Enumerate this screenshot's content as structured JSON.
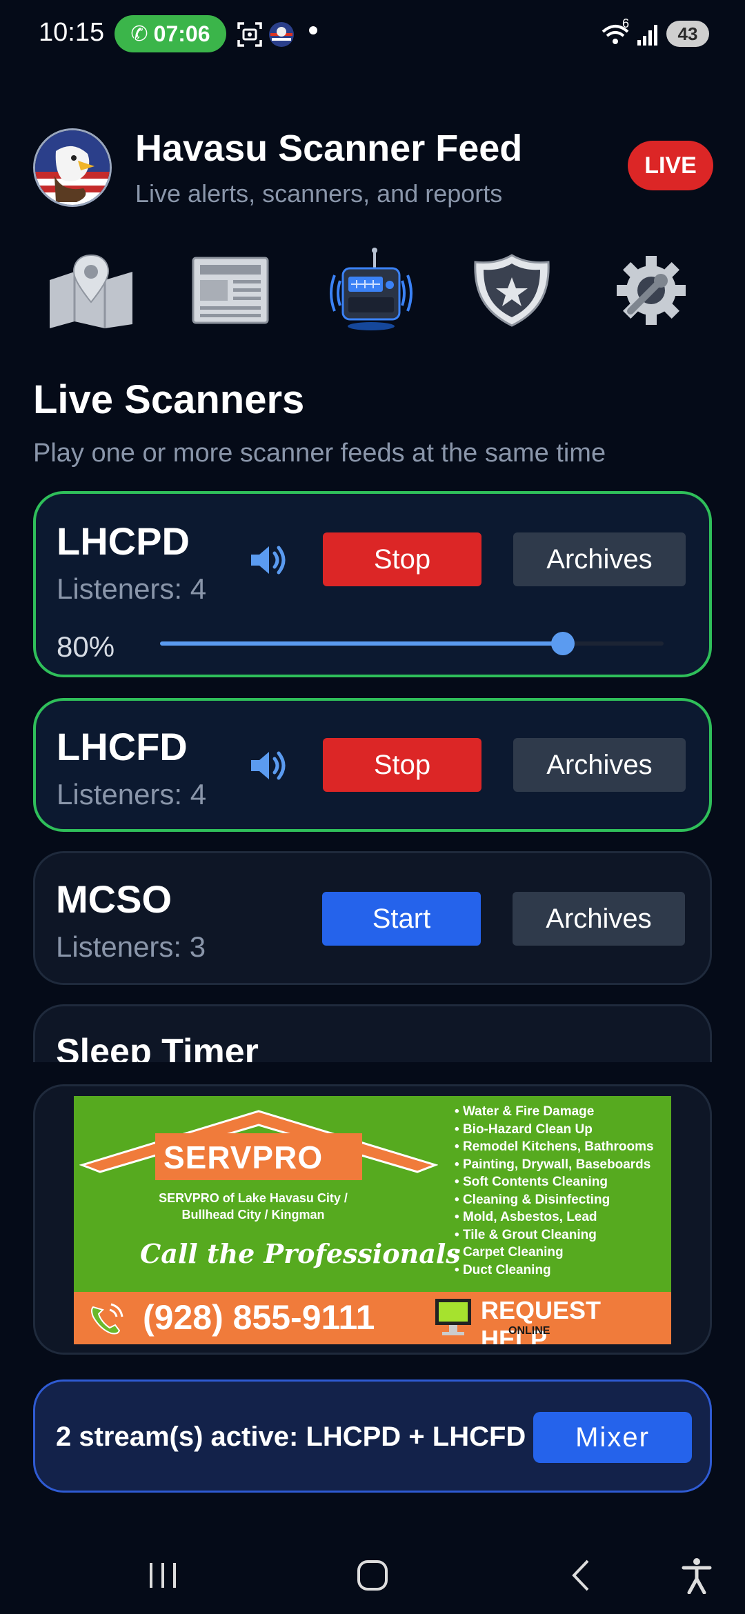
{
  "status_bar": {
    "time": "10:15",
    "call_time": "07:06",
    "battery": "43",
    "network_label": "6"
  },
  "header": {
    "title": "Havasu Scanner Feed",
    "subtitle": "Live alerts, scanners, and reports",
    "live_badge": "LIVE"
  },
  "nav": [
    {
      "icon": "map-pin-icon"
    },
    {
      "icon": "newspaper-icon"
    },
    {
      "icon": "radio-scanner-icon"
    },
    {
      "icon": "police-badge-icon"
    },
    {
      "icon": "settings-gear-icon"
    }
  ],
  "section": {
    "title": "Live Scanners",
    "subtitle": "Play one or more scanner feeds at the same time"
  },
  "feeds": [
    {
      "name": "LHCPD",
      "listeners": "Listeners: 4",
      "action": "Stop",
      "archives": "Archives",
      "volume_label": "80%",
      "volume": 0.8,
      "active": true
    },
    {
      "name": "LHCFD",
      "listeners": "Listeners: 4",
      "action": "Stop",
      "archives": "Archives",
      "active": true
    },
    {
      "name": "MCSO",
      "listeners": "Listeners: 3",
      "action": "Start",
      "archives": "Archives",
      "active": false
    }
  ],
  "sleep_timer": {
    "title": "Sleep Timer"
  },
  "ad": {
    "brand": "SERVPRO",
    "city_line_1": "SERVPRO of Lake Havasu City /",
    "city_line_2": "Bullhead City / Kingman",
    "tagline": "Call the Professionals",
    "services": [
      "Water & Fire Damage",
      "Bio-Hazard Clean Up",
      "Remodel Kitchens, Bathrooms",
      "Painting, Drywall, Baseboards",
      "Soft Contents Cleaning",
      "Cleaning & Disinfecting",
      "Mold, Asbestos, Lead",
      "Tile & Grout Cleaning",
      "Carpet Cleaning",
      "Duct Cleaning"
    ],
    "phone": "(928) 855-9111",
    "request": "REQUEST HELP",
    "online": "ONLINE"
  },
  "streams": {
    "text": "2 stream(s) active: LHCPD + LHCFD",
    "mixer_label": "Mixer"
  },
  "colors": {
    "background": "#050b18",
    "live_red": "#dc2626",
    "start_blue": "#2563eb",
    "active_green": "#2fbf5a",
    "muted_text": "#8a96aa"
  }
}
